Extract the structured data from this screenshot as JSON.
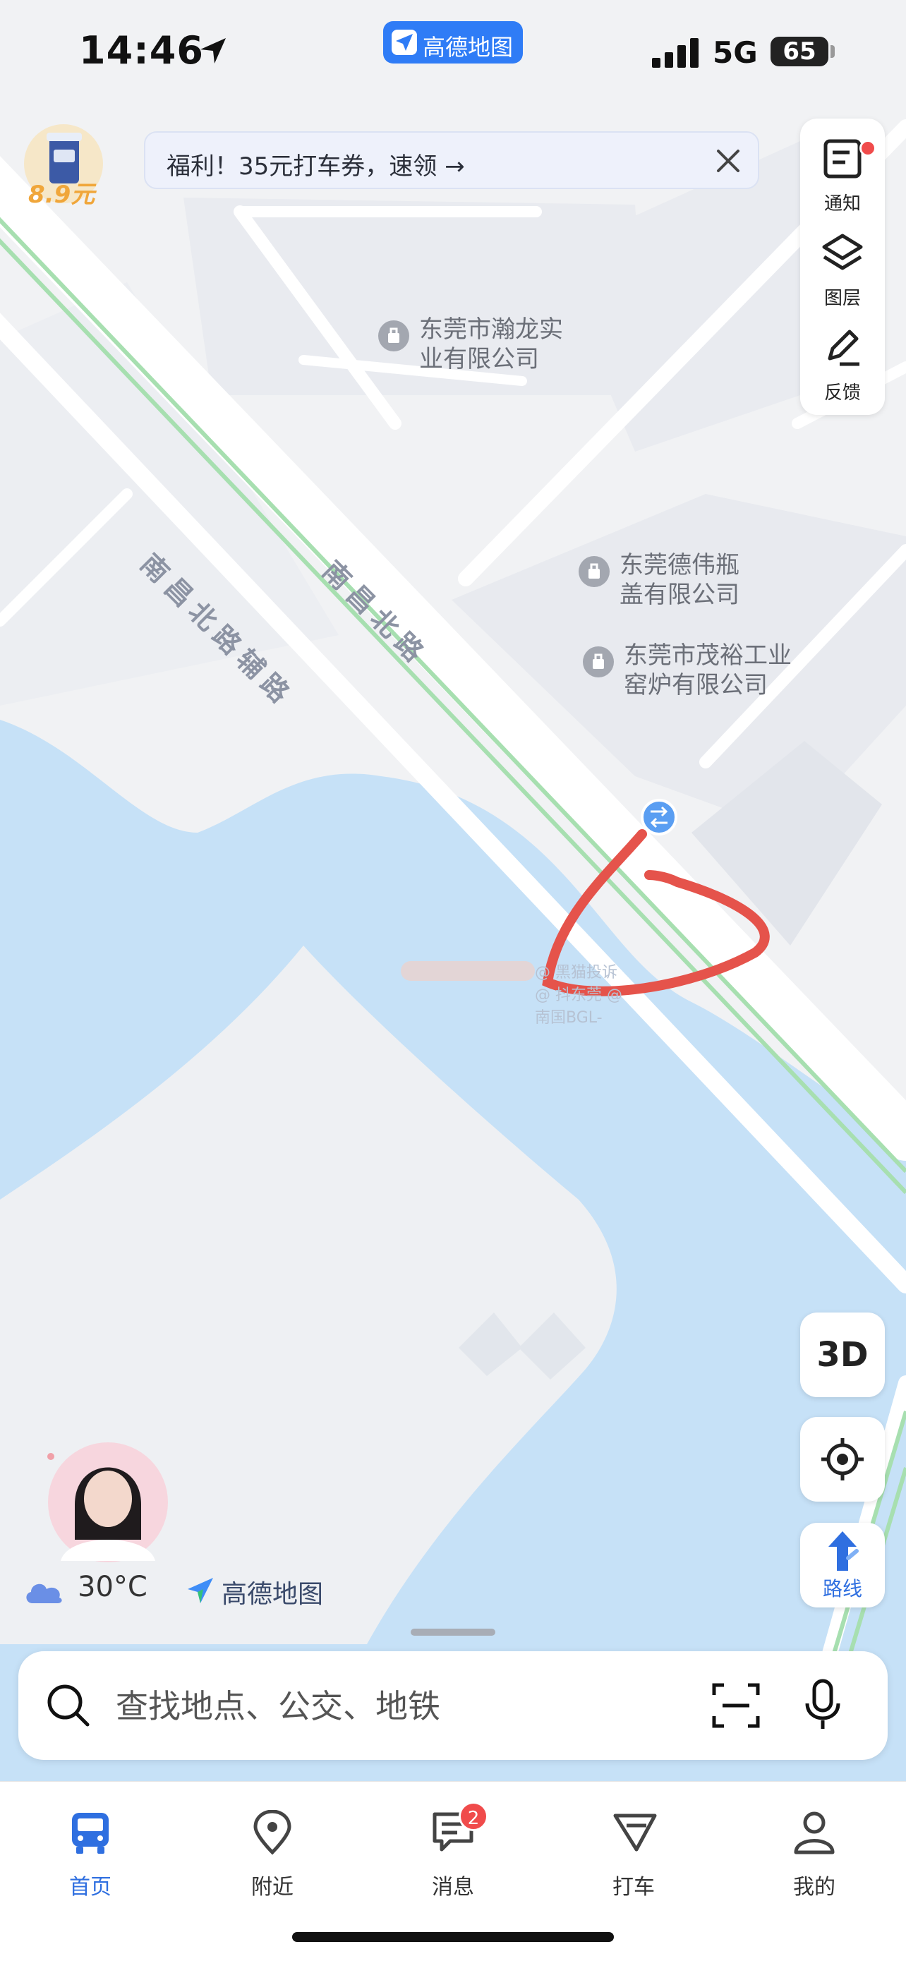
{
  "status_bar": {
    "time": "14:46",
    "app_pill": "高德地图",
    "network": "5G",
    "battery": "65"
  },
  "promo": {
    "price": "8.9元",
    "banner_text": "福利！35元打车券，速领 →"
  },
  "tools": [
    {
      "label": "通知",
      "icon": "notice-icon"
    },
    {
      "label": "图层",
      "icon": "layers-icon"
    },
    {
      "label": "反馈",
      "icon": "feedback-icon"
    }
  ],
  "map": {
    "pois": [
      {
        "line1": "东莞市瀚龙实",
        "line2": "业有限公司"
      },
      {
        "line1": "东莞德伟瓶",
        "line2": "盖有限公司"
      },
      {
        "line1": "东莞市茂裕工业",
        "line2": "窑炉有限公司"
      }
    ],
    "roads": [
      "南昌北路辅路",
      "南昌北路"
    ],
    "watermark": "@ 黑猫投诉  @ 抖东莞  @ 南国BGL-"
  },
  "controls": {
    "btn_3d": "3D",
    "route_label": "路线"
  },
  "weather": {
    "temp": "30°C",
    "brand": "高德地图"
  },
  "search": {
    "placeholder": "查找地点、公交、地铁"
  },
  "nav": [
    {
      "label": "首页",
      "icon": "bus-icon",
      "active": true
    },
    {
      "label": "附近",
      "icon": "location-pin-icon"
    },
    {
      "label": "消息",
      "icon": "message-icon",
      "badge": "2"
    },
    {
      "label": "打车",
      "icon": "taxi-icon"
    },
    {
      "label": "我的",
      "icon": "profile-icon"
    }
  ],
  "colors": {
    "water": "#c6e1f7",
    "land": "#f1f2f4",
    "road": "#ffffff",
    "rail_green": "#a7dfb0",
    "accent": "#2f6fe0",
    "annotation_red": "#e5534b"
  }
}
